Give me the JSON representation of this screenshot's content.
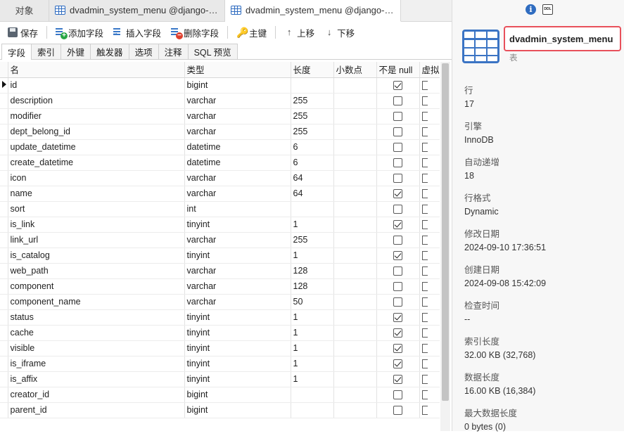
{
  "tabs": [
    {
      "label": "对象",
      "icon": "none"
    },
    {
      "label": "dvadmin_system_menu @django-vu...",
      "icon": "table-icon"
    },
    {
      "label": "dvadmin_system_menu @django-vu...",
      "icon": "table-design-icon"
    }
  ],
  "toolbar": {
    "save": "保存",
    "add_field": "添加字段",
    "insert_field": "插入字段",
    "delete_field": "删除字段",
    "primary_key": "主键",
    "move_up": "上移",
    "move_down": "下移"
  },
  "subtabs": [
    "字段",
    "索引",
    "外键",
    "触发器",
    "选项",
    "注释",
    "SQL 预览"
  ],
  "columns": {
    "name": "名",
    "type": "类型",
    "length": "长度",
    "decimals": "小数点",
    "not_null": "不是 null",
    "virtual": "虚拟"
  },
  "rows": [
    {
      "name": "id",
      "type": "bigint",
      "length": "",
      "not_null": true
    },
    {
      "name": "description",
      "type": "varchar",
      "length": "255",
      "not_null": false
    },
    {
      "name": "modifier",
      "type": "varchar",
      "length": "255",
      "not_null": false
    },
    {
      "name": "dept_belong_id",
      "type": "varchar",
      "length": "255",
      "not_null": false
    },
    {
      "name": "update_datetime",
      "type": "datetime",
      "length": "6",
      "not_null": false
    },
    {
      "name": "create_datetime",
      "type": "datetime",
      "length": "6",
      "not_null": false
    },
    {
      "name": "icon",
      "type": "varchar",
      "length": "64",
      "not_null": false
    },
    {
      "name": "name",
      "type": "varchar",
      "length": "64",
      "not_null": true
    },
    {
      "name": "sort",
      "type": "int",
      "length": "",
      "not_null": false
    },
    {
      "name": "is_link",
      "type": "tinyint",
      "length": "1",
      "not_null": true
    },
    {
      "name": "link_url",
      "type": "varchar",
      "length": "255",
      "not_null": false
    },
    {
      "name": "is_catalog",
      "type": "tinyint",
      "length": "1",
      "not_null": true
    },
    {
      "name": "web_path",
      "type": "varchar",
      "length": "128",
      "not_null": false
    },
    {
      "name": "component",
      "type": "varchar",
      "length": "128",
      "not_null": false
    },
    {
      "name": "component_name",
      "type": "varchar",
      "length": "50",
      "not_null": false
    },
    {
      "name": "status",
      "type": "tinyint",
      "length": "1",
      "not_null": true
    },
    {
      "name": "cache",
      "type": "tinyint",
      "length": "1",
      "not_null": true
    },
    {
      "name": "visible",
      "type": "tinyint",
      "length": "1",
      "not_null": true
    },
    {
      "name": "is_iframe",
      "type": "tinyint",
      "length": "1",
      "not_null": true
    },
    {
      "name": "is_affix",
      "type": "tinyint",
      "length": "1",
      "not_null": true
    },
    {
      "name": "creator_id",
      "type": "bigint",
      "length": "",
      "not_null": false
    },
    {
      "name": "parent_id",
      "type": "bigint",
      "length": "",
      "not_null": false
    }
  ],
  "panel": {
    "table_name": "dvadmin_system_menu",
    "object_type": "表",
    "ddl_label": "DDL",
    "info_glyph": "i",
    "props": [
      {
        "key": "行",
        "value": "17"
      },
      {
        "key": "引擎",
        "value": "InnoDB"
      },
      {
        "key": "自动递增",
        "value": "18"
      },
      {
        "key": "行格式",
        "value": "Dynamic"
      },
      {
        "key": "修改日期",
        "value": "2024-09-10 17:36:51"
      },
      {
        "key": "创建日期",
        "value": "2024-09-08 15:42:09"
      },
      {
        "key": "检查时间",
        "value": "--"
      },
      {
        "key": "索引长度",
        "value": "32.00 KB (32,768)"
      },
      {
        "key": "数据长度",
        "value": "16.00 KB (16,384)"
      },
      {
        "key": "最大数据长度",
        "value": "0 bytes (0)"
      }
    ]
  },
  "colors": {
    "accent": "#2f6cc0",
    "highlight_border": "#e8505b"
  }
}
